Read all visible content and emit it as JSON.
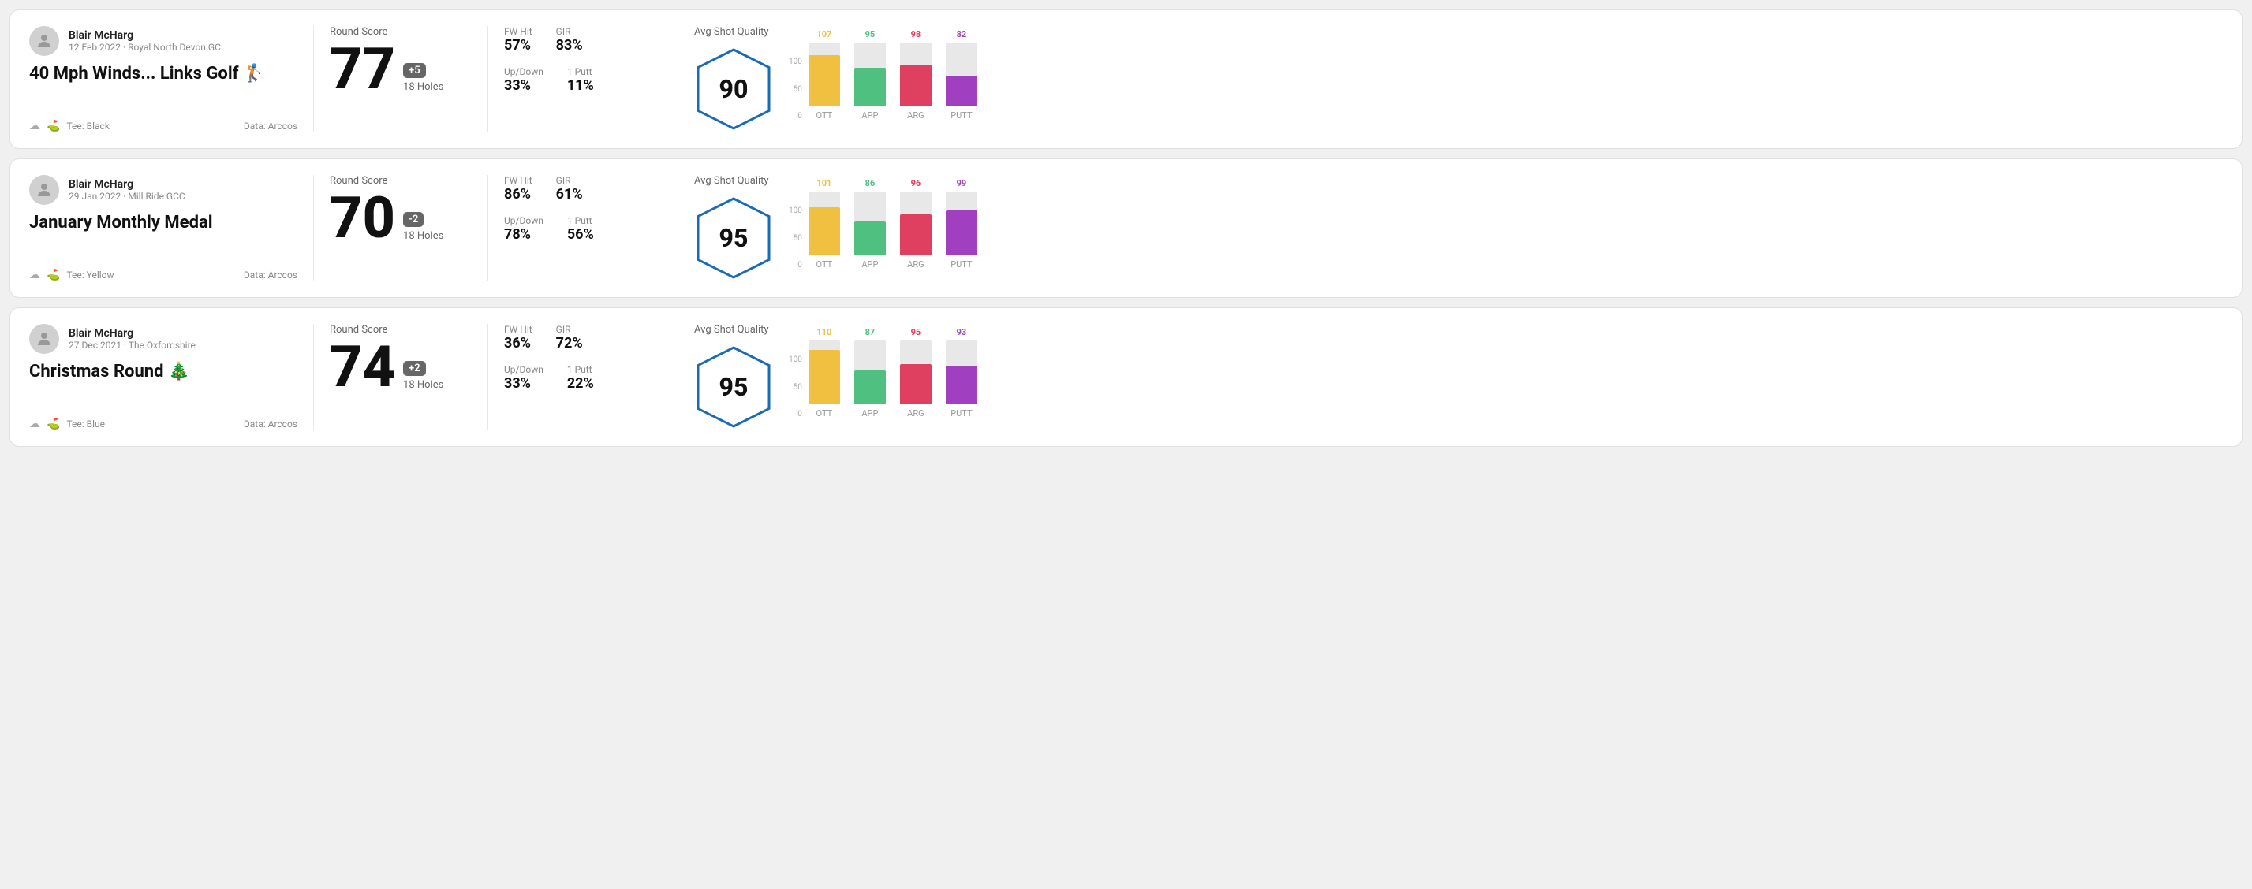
{
  "rounds": [
    {
      "id": "round1",
      "user_name": "Blair McHarg",
      "date_course": "12 Feb 2022 · Royal North Devon GC",
      "title": "40 Mph Winds... Links Golf 🏌️",
      "tee": "Tee: Black",
      "data_source": "Data: Arccos",
      "score": "77",
      "score_diff": "+5",
      "holes": "18 Holes",
      "fw_hit_label": "FW Hit",
      "fw_hit": "57%",
      "gir_label": "GIR",
      "gir": "83%",
      "updown_label": "Up/Down",
      "updown": "33%",
      "oneputt_label": "1 Putt",
      "oneputt": "11%",
      "avg_sq_label": "Avg Shot Quality",
      "sq_score": "90",
      "chart": {
        "ott": {
          "value": 107,
          "height_pct": 80
        },
        "app": {
          "value": 95,
          "height_pct": 60
        },
        "arg": {
          "value": 98,
          "height_pct": 65
        },
        "putt": {
          "value": 82,
          "height_pct": 48
        }
      },
      "badge_class": "badge-positive"
    },
    {
      "id": "round2",
      "user_name": "Blair McHarg",
      "date_course": "29 Jan 2022 · Mill Ride GCC",
      "title": "January Monthly Medal",
      "tee": "Tee: Yellow",
      "data_source": "Data: Arccos",
      "score": "70",
      "score_diff": "-2",
      "holes": "18 Holes",
      "fw_hit_label": "FW Hit",
      "fw_hit": "86%",
      "gir_label": "GIR",
      "gir": "61%",
      "updown_label": "Up/Down",
      "updown": "78%",
      "oneputt_label": "1 Putt",
      "oneputt": "56%",
      "avg_sq_label": "Avg Shot Quality",
      "sq_score": "95",
      "chart": {
        "ott": {
          "value": 101,
          "height_pct": 75
        },
        "app": {
          "value": 86,
          "height_pct": 52
        },
        "arg": {
          "value": 96,
          "height_pct": 64
        },
        "putt": {
          "value": 99,
          "height_pct": 70
        }
      },
      "badge_class": "badge-negative"
    },
    {
      "id": "round3",
      "user_name": "Blair McHarg",
      "date_course": "27 Dec 2021 · The Oxfordshire",
      "title": "Christmas Round 🎄",
      "tee": "Tee: Blue",
      "data_source": "Data: Arccos",
      "score": "74",
      "score_diff": "+2",
      "holes": "18 Holes",
      "fw_hit_label": "FW Hit",
      "fw_hit": "36%",
      "gir_label": "GIR",
      "gir": "72%",
      "updown_label": "Up/Down",
      "updown": "33%",
      "oneputt_label": "1 Putt",
      "oneputt": "22%",
      "avg_sq_label": "Avg Shot Quality",
      "sq_score": "95",
      "chart": {
        "ott": {
          "value": 110,
          "height_pct": 85
        },
        "app": {
          "value": 87,
          "height_pct": 53
        },
        "arg": {
          "value": 95,
          "height_pct": 63
        },
        "putt": {
          "value": 93,
          "height_pct": 60
        }
      },
      "badge_class": "badge-positive"
    }
  ],
  "chart_labels": {
    "ott": "OTT",
    "app": "APP",
    "arg": "ARG",
    "putt": "PUTT"
  },
  "y_axis": [
    "0",
    "50",
    "100"
  ]
}
